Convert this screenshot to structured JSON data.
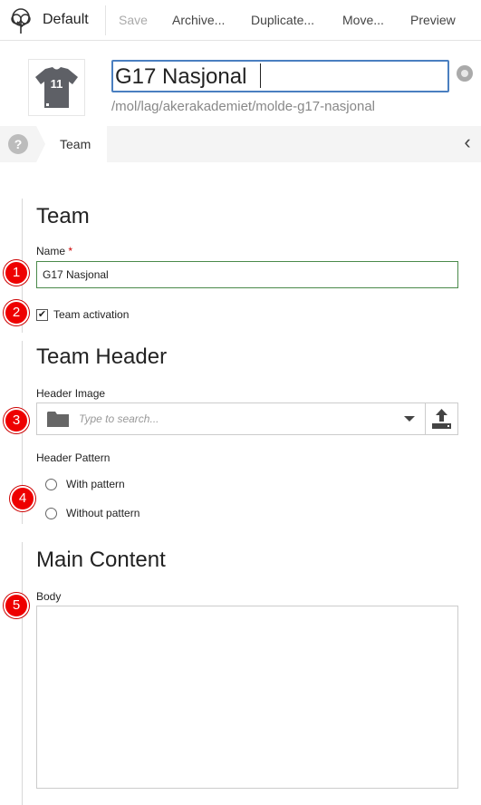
{
  "toolbar": {
    "app_label": "Default",
    "save": "Save",
    "archive": "Archive...",
    "duplicate": "Duplicate...",
    "move": "Move...",
    "preview": "Preview"
  },
  "header": {
    "thumbnail_number": "11",
    "name_value": "G17 Nasjonal",
    "path": "/mol/lag/akerakademiet/molde-g17-nasjonal"
  },
  "tabs": {
    "help": "?",
    "active_tab": "Team",
    "collapse": "‹"
  },
  "form": {
    "team_section": "Team",
    "name_label": "Name",
    "name_required": "*",
    "name_value": "G17 Nasjonal",
    "activation_label": "Team activation",
    "activation_checked": true,
    "header_section": "Team Header",
    "header_image_label": "Header Image",
    "header_image_placeholder": "Type to search...",
    "header_pattern_label": "Header Pattern",
    "pattern_options": [
      "With pattern",
      "Without pattern"
    ],
    "main_section": "Main Content",
    "body_label": "Body"
  },
  "markers": [
    "1",
    "2",
    "3",
    "4",
    "5"
  ],
  "colors": {
    "focus_border": "#4a7fc0",
    "valid_border": "#4a8a4a",
    "marker": "#e00000"
  }
}
